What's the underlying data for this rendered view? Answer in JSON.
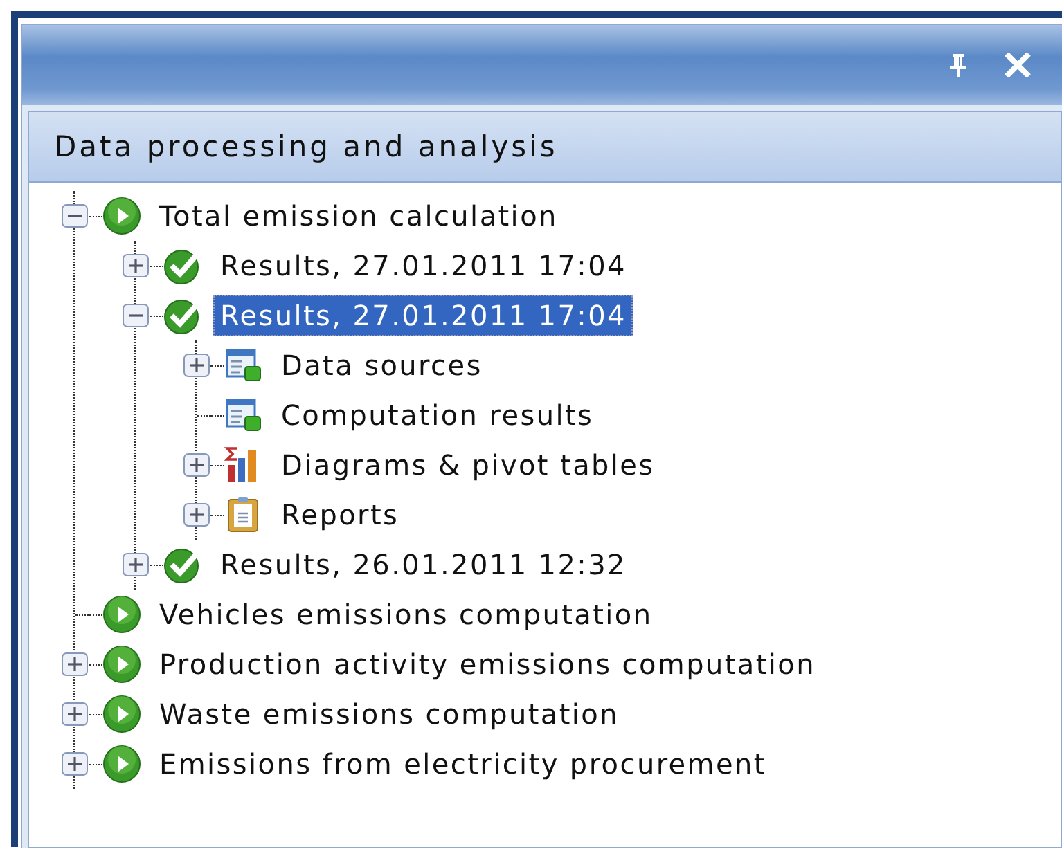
{
  "panel": {
    "title": "Data processing and analysis"
  },
  "tree": [
    {
      "label": "Total emission calculation",
      "kind": "process",
      "expanded": true,
      "selected": false,
      "children": [
        {
          "label": "Results, 27.01.2011 17:04",
          "kind": "result",
          "expanded": false,
          "selected": false
        },
        {
          "label": "Results, 27.01.2011 17:04",
          "kind": "result",
          "expanded": true,
          "selected": true,
          "children": [
            {
              "label": "Data sources",
              "kind": "table",
              "expanded": false,
              "selected": false
            },
            {
              "label": "Computation results",
              "kind": "table",
              "selected": false
            },
            {
              "label": "Diagrams & pivot tables",
              "kind": "chart",
              "expanded": false,
              "selected": false
            },
            {
              "label": "Reports",
              "kind": "report",
              "expanded": false,
              "selected": false
            }
          ]
        },
        {
          "label": "Results, 26.01.2011 12:32",
          "kind": "result",
          "expanded": false,
          "selected": false
        }
      ]
    },
    {
      "label": "Vehicles emissions computation",
      "kind": "process",
      "selected": false
    },
    {
      "label": "Production activity emissions computation",
      "kind": "process",
      "expanded": false,
      "selected": false
    },
    {
      "label": "Waste emissions computation",
      "kind": "process",
      "expanded": false,
      "selected": false
    },
    {
      "label": "Emissions from electricity procurement",
      "kind": "process",
      "expanded": false,
      "selected": false
    }
  ]
}
